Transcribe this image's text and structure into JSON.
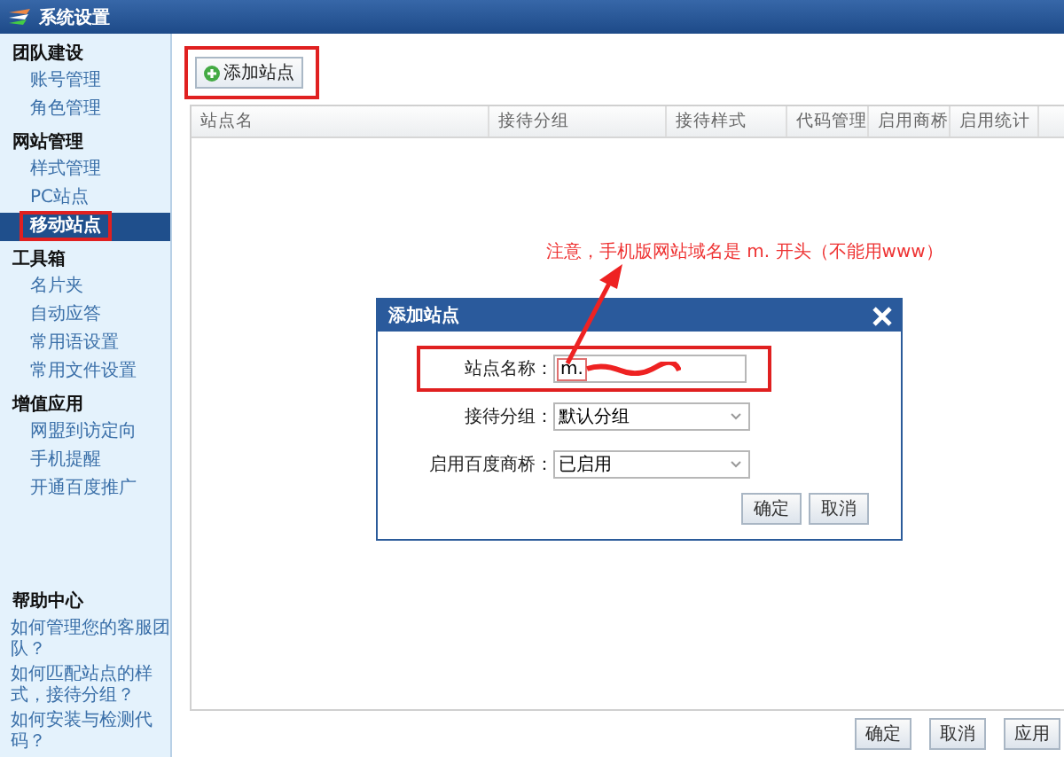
{
  "window": {
    "title": "系统设置"
  },
  "sidebar": {
    "sections": [
      {
        "title": "团队建设",
        "items": [
          {
            "label": "账号管理",
            "selected": false,
            "highlighted": false
          },
          {
            "label": "角色管理",
            "selected": false,
            "highlighted": false
          }
        ]
      },
      {
        "title": "网站管理",
        "items": [
          {
            "label": "样式管理",
            "selected": false,
            "highlighted": false
          },
          {
            "label": "PC站点",
            "selected": false,
            "highlighted": false
          },
          {
            "label": "移动站点",
            "selected": true,
            "highlighted": true
          }
        ]
      },
      {
        "title": "工具箱",
        "items": [
          {
            "label": "名片夹",
            "selected": false,
            "highlighted": false
          },
          {
            "label": "自动应答",
            "selected": false,
            "highlighted": false
          },
          {
            "label": "常用语设置",
            "selected": false,
            "highlighted": false
          },
          {
            "label": "常用文件设置",
            "selected": false,
            "highlighted": false
          }
        ]
      },
      {
        "title": "增值应用",
        "items": [
          {
            "label": "网盟到访定向",
            "selected": false,
            "highlighted": false
          },
          {
            "label": "手机提醒",
            "selected": false,
            "highlighted": false
          },
          {
            "label": "开通百度推广",
            "selected": false,
            "highlighted": false
          }
        ]
      }
    ],
    "help": {
      "title": "帮助中心",
      "links": [
        "如何管理您的客服团队？",
        "如何匹配站点的样式，接待分组？",
        "如何安装与检测代码？"
      ]
    }
  },
  "toolbar": {
    "add_button": {
      "label": "添加站点",
      "highlighted": true
    }
  },
  "table": {
    "columns": [
      "站点名",
      "接待分组",
      "接待样式",
      "代码管理",
      "启用商桥",
      "启用统计"
    ]
  },
  "footer_buttons": [
    "确定",
    "取消",
    "应用"
  ],
  "annotation": {
    "text": "注意，手机版网站域名是 m. 开头（不能用www）"
  },
  "dialog": {
    "title": "添加站点",
    "fields": [
      {
        "kind": "input",
        "label": "站点名称：",
        "value": "m.",
        "highlighted": true
      },
      {
        "kind": "select",
        "label": "接待分组：",
        "value": "默认分组",
        "highlighted": false
      },
      {
        "kind": "select",
        "label": "启用百度商桥：",
        "value": "已启用",
        "highlighted": false
      }
    ],
    "buttons": [
      "确定",
      "取消"
    ]
  }
}
